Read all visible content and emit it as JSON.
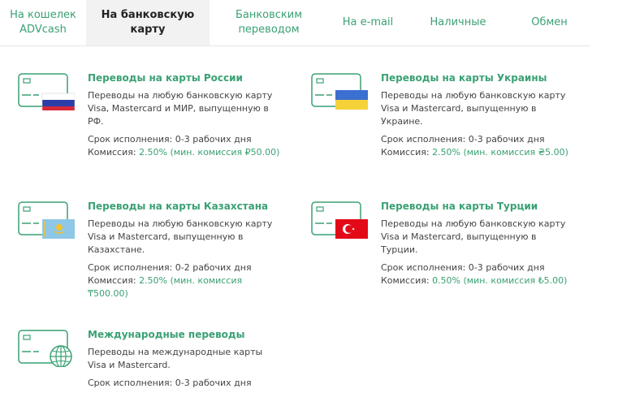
{
  "tabs": [
    {
      "label": "На кошелек ADVcash",
      "active": false
    },
    {
      "label": "На банковскую карту",
      "active": true
    },
    {
      "label": "Банковским переводом",
      "active": false
    },
    {
      "label": "На e-mail",
      "active": false
    },
    {
      "label": "Наличные",
      "active": false
    },
    {
      "label": "Обмен",
      "active": false
    }
  ],
  "cards": [
    {
      "icon": "russia-flag-card-icon",
      "title": "Переводы на карты России",
      "description": "Переводы на любую банковскую карту Visa, Mastercard и МИР, выпущенную в РФ.",
      "term_label": "Срок исполнения: 0-3 рабочих дня",
      "fee_label": "Комиссия:",
      "fee_value": "2.50% (мин. комиссия ₽50.00)"
    },
    {
      "icon": "ukraine-flag-card-icon",
      "title": "Переводы на карты Украины",
      "description": "Переводы на любую банковскую карту Visa и Mastercard, выпущенную в Украине.",
      "term_label": "Срок исполнения: 0-3 рабочих дня",
      "fee_label": "Комиссия:",
      "fee_value": "2.50% (мин. комиссия ₴5.00)"
    },
    {
      "icon": "kazakhstan-flag-card-icon",
      "title": "Переводы на карты Казахстана",
      "description": "Переводы на любую банковскую карту Visa и Mastercard, выпущенную в Казахстане.",
      "term_label": "Срок исполнения: 0-2 рабочих дня",
      "fee_label": "Комиссия:",
      "fee_value": "2.50% (мин. комиссия ₸500.00)"
    },
    {
      "icon": "turkey-flag-card-icon",
      "title": "Переводы на карты Турции",
      "description": "Переводы на любую банковскую карту Visa и Mastercard, выпущенную в Турции.",
      "term_label": "Срок исполнения: 0-3 рабочих дня",
      "fee_label": "Комиссия:",
      "fee_value": "0.50% (мин. комиссия ₺5.00)"
    },
    {
      "icon": "globe-card-icon",
      "title": "Международные переводы",
      "description": "Переводы на международные карты Visa и Mastercard.",
      "term_label": "Срок исполнения: 0-3 рабочих дня",
      "fee_label": "",
      "fee_value": ""
    }
  ],
  "colors": {
    "accent": "#3aa173",
    "active_tab_bg": "#f2f2f2"
  }
}
